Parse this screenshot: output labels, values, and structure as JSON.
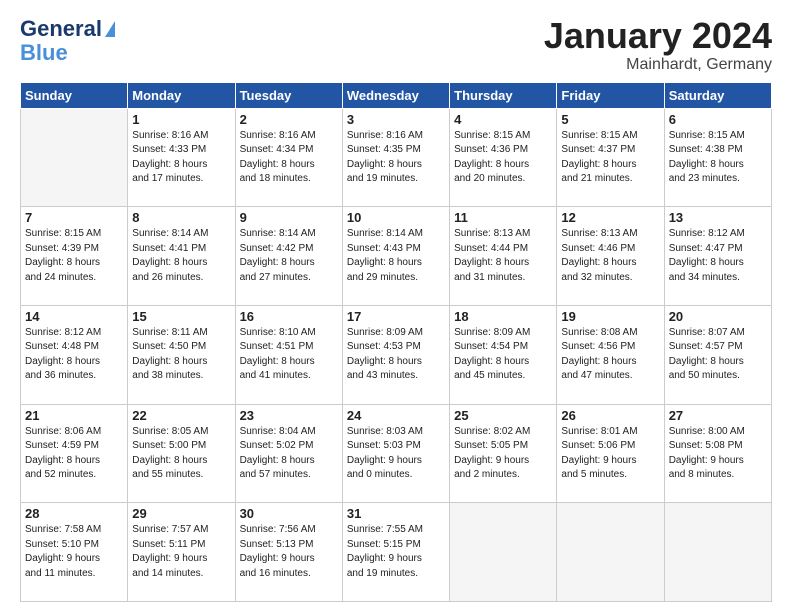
{
  "logo": {
    "line1": "General",
    "line2": "Blue"
  },
  "title": "January 2024",
  "location": "Mainhardt, Germany",
  "weekdays": [
    "Sunday",
    "Monday",
    "Tuesday",
    "Wednesday",
    "Thursday",
    "Friday",
    "Saturday"
  ],
  "weeks": [
    [
      {
        "day": "",
        "info": ""
      },
      {
        "day": "1",
        "info": "Sunrise: 8:16 AM\nSunset: 4:33 PM\nDaylight: 8 hours\nand 17 minutes."
      },
      {
        "day": "2",
        "info": "Sunrise: 8:16 AM\nSunset: 4:34 PM\nDaylight: 8 hours\nand 18 minutes."
      },
      {
        "day": "3",
        "info": "Sunrise: 8:16 AM\nSunset: 4:35 PM\nDaylight: 8 hours\nand 19 minutes."
      },
      {
        "day": "4",
        "info": "Sunrise: 8:15 AM\nSunset: 4:36 PM\nDaylight: 8 hours\nand 20 minutes."
      },
      {
        "day": "5",
        "info": "Sunrise: 8:15 AM\nSunset: 4:37 PM\nDaylight: 8 hours\nand 21 minutes."
      },
      {
        "day": "6",
        "info": "Sunrise: 8:15 AM\nSunset: 4:38 PM\nDaylight: 8 hours\nand 23 minutes."
      }
    ],
    [
      {
        "day": "7",
        "info": "Sunrise: 8:15 AM\nSunset: 4:39 PM\nDaylight: 8 hours\nand 24 minutes."
      },
      {
        "day": "8",
        "info": "Sunrise: 8:14 AM\nSunset: 4:41 PM\nDaylight: 8 hours\nand 26 minutes."
      },
      {
        "day": "9",
        "info": "Sunrise: 8:14 AM\nSunset: 4:42 PM\nDaylight: 8 hours\nand 27 minutes."
      },
      {
        "day": "10",
        "info": "Sunrise: 8:14 AM\nSunset: 4:43 PM\nDaylight: 8 hours\nand 29 minutes."
      },
      {
        "day": "11",
        "info": "Sunrise: 8:13 AM\nSunset: 4:44 PM\nDaylight: 8 hours\nand 31 minutes."
      },
      {
        "day": "12",
        "info": "Sunrise: 8:13 AM\nSunset: 4:46 PM\nDaylight: 8 hours\nand 32 minutes."
      },
      {
        "day": "13",
        "info": "Sunrise: 8:12 AM\nSunset: 4:47 PM\nDaylight: 8 hours\nand 34 minutes."
      }
    ],
    [
      {
        "day": "14",
        "info": "Sunrise: 8:12 AM\nSunset: 4:48 PM\nDaylight: 8 hours\nand 36 minutes."
      },
      {
        "day": "15",
        "info": "Sunrise: 8:11 AM\nSunset: 4:50 PM\nDaylight: 8 hours\nand 38 minutes."
      },
      {
        "day": "16",
        "info": "Sunrise: 8:10 AM\nSunset: 4:51 PM\nDaylight: 8 hours\nand 41 minutes."
      },
      {
        "day": "17",
        "info": "Sunrise: 8:09 AM\nSunset: 4:53 PM\nDaylight: 8 hours\nand 43 minutes."
      },
      {
        "day": "18",
        "info": "Sunrise: 8:09 AM\nSunset: 4:54 PM\nDaylight: 8 hours\nand 45 minutes."
      },
      {
        "day": "19",
        "info": "Sunrise: 8:08 AM\nSunset: 4:56 PM\nDaylight: 8 hours\nand 47 minutes."
      },
      {
        "day": "20",
        "info": "Sunrise: 8:07 AM\nSunset: 4:57 PM\nDaylight: 8 hours\nand 50 minutes."
      }
    ],
    [
      {
        "day": "21",
        "info": "Sunrise: 8:06 AM\nSunset: 4:59 PM\nDaylight: 8 hours\nand 52 minutes."
      },
      {
        "day": "22",
        "info": "Sunrise: 8:05 AM\nSunset: 5:00 PM\nDaylight: 8 hours\nand 55 minutes."
      },
      {
        "day": "23",
        "info": "Sunrise: 8:04 AM\nSunset: 5:02 PM\nDaylight: 8 hours\nand 57 minutes."
      },
      {
        "day": "24",
        "info": "Sunrise: 8:03 AM\nSunset: 5:03 PM\nDaylight: 9 hours\nand 0 minutes."
      },
      {
        "day": "25",
        "info": "Sunrise: 8:02 AM\nSunset: 5:05 PM\nDaylight: 9 hours\nand 2 minutes."
      },
      {
        "day": "26",
        "info": "Sunrise: 8:01 AM\nSunset: 5:06 PM\nDaylight: 9 hours\nand 5 minutes."
      },
      {
        "day": "27",
        "info": "Sunrise: 8:00 AM\nSunset: 5:08 PM\nDaylight: 9 hours\nand 8 minutes."
      }
    ],
    [
      {
        "day": "28",
        "info": "Sunrise: 7:58 AM\nSunset: 5:10 PM\nDaylight: 9 hours\nand 11 minutes."
      },
      {
        "day": "29",
        "info": "Sunrise: 7:57 AM\nSunset: 5:11 PM\nDaylight: 9 hours\nand 14 minutes."
      },
      {
        "day": "30",
        "info": "Sunrise: 7:56 AM\nSunset: 5:13 PM\nDaylight: 9 hours\nand 16 minutes."
      },
      {
        "day": "31",
        "info": "Sunrise: 7:55 AM\nSunset: 5:15 PM\nDaylight: 9 hours\nand 19 minutes."
      },
      {
        "day": "",
        "info": ""
      },
      {
        "day": "",
        "info": ""
      },
      {
        "day": "",
        "info": ""
      }
    ]
  ]
}
